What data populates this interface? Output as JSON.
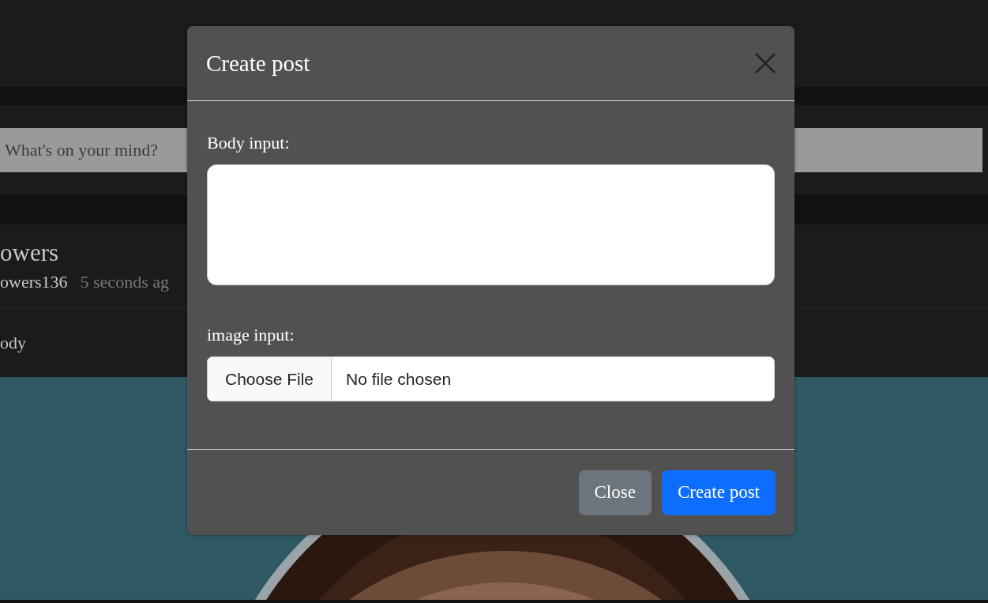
{
  "feed": {
    "composer": {
      "placeholder": "What's on your mind?"
    },
    "post": {
      "author": "owers",
      "username": "owers136",
      "time": "5 seconds ag",
      "body": "ody"
    }
  },
  "modal": {
    "title": "Create post",
    "fields": [
      {
        "kind": "textarea",
        "label": "Body input:"
      },
      {
        "kind": "file",
        "label": "image input:",
        "button": "Choose File",
        "status": "No file chosen"
      }
    ],
    "buttons": [
      {
        "kind": "secondary",
        "label": "Close"
      },
      {
        "kind": "primary",
        "label": "Create post"
      }
    ]
  }
}
